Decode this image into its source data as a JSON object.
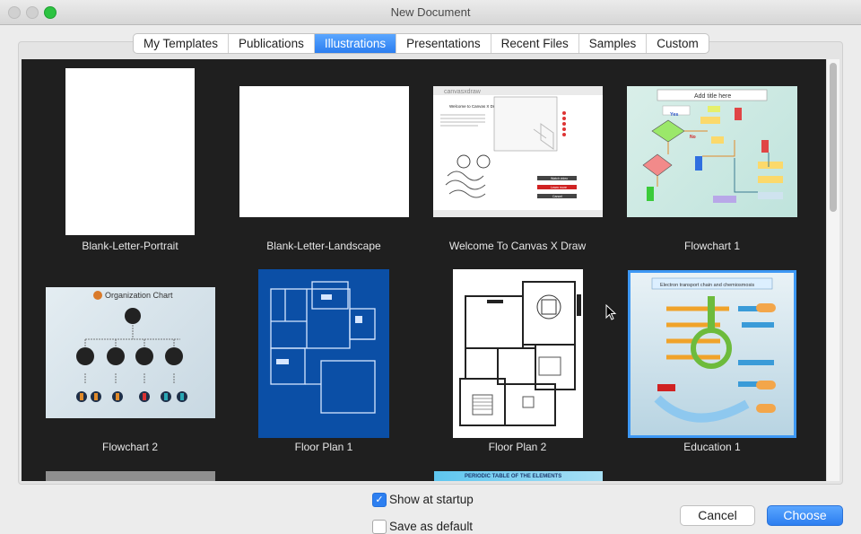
{
  "window": {
    "title": "New Document"
  },
  "tabs": [
    {
      "label": "My Templates"
    },
    {
      "label": "Publications"
    },
    {
      "label": "Illustrations",
      "active": true
    },
    {
      "label": "Presentations"
    },
    {
      "label": "Recent Files"
    },
    {
      "label": "Samples"
    },
    {
      "label": "Custom"
    }
  ],
  "templates": [
    {
      "label": "Blank-Letter-Portrait"
    },
    {
      "label": "Blank-Letter-Landscape"
    },
    {
      "label": "Welcome To Canvas X Draw",
      "thumb": {
        "brand": "canvasxdraw",
        "heading": "Welcome to Canvas X Draw!",
        "buttons": [
          "Watch video",
          "Learn more",
          "Cancel"
        ]
      }
    },
    {
      "label": "Flowchart 1",
      "thumb": {
        "title": "Add title here",
        "yes": "Yes",
        "no": "No"
      }
    },
    {
      "label": "Flowchart 2",
      "thumb": {
        "title": "Organization Chart"
      }
    },
    {
      "label": "Floor Plan 1"
    },
    {
      "label": "Floor Plan 2"
    },
    {
      "label": "Education 1",
      "selected": true,
      "thumb": {
        "title": "Electron transport chain and chemiosmosis"
      }
    },
    {
      "label": "",
      "partial": true
    },
    {
      "label": "",
      "partial": true,
      "thumb": {
        "title": "PERIODIC TABLE OF THE ELEMENTS"
      }
    }
  ],
  "footer": {
    "show_startup": {
      "label": "Show at startup",
      "checked": true
    },
    "save_default": {
      "label": "Save as default",
      "checked": false
    },
    "cancel": "Cancel",
    "choose": "Choose"
  },
  "colors": {
    "accent": "#2c7ef0",
    "selection": "#3d98f4",
    "gallery_bg": "#1f1f1f"
  }
}
